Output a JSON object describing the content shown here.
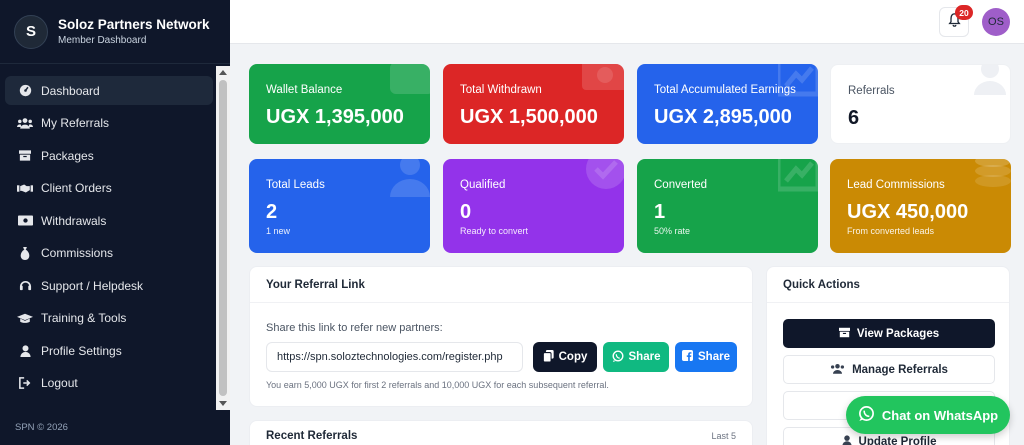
{
  "brand": {
    "initial": "S",
    "name": "Soloz Partners Network",
    "subtitle": "Member Dashboard"
  },
  "nav": [
    {
      "label": "Dashboard",
      "icon": "dashboard-icon",
      "active": true
    },
    {
      "label": "My Referrals",
      "icon": "users-icon"
    },
    {
      "label": "Packages",
      "icon": "box-icon"
    },
    {
      "label": "Client Orders",
      "icon": "handshake-icon"
    },
    {
      "label": "Withdrawals",
      "icon": "money-icon"
    },
    {
      "label": "Commissions",
      "icon": "money-bag-icon"
    },
    {
      "label": "Support / Helpdesk",
      "icon": "headset-icon"
    },
    {
      "label": "Training & Tools",
      "icon": "graduation-cap-icon"
    },
    {
      "label": "Profile Settings",
      "icon": "user-icon"
    },
    {
      "label": "Logout",
      "icon": "logout-icon"
    }
  ],
  "footer": "SPN © 2026",
  "topbar": {
    "notification_count": "20",
    "avatar_initials": "OS"
  },
  "stats": {
    "wallet": {
      "label": "Wallet Balance",
      "value": "UGX 1,395,000"
    },
    "withdrawn": {
      "label": "Total Withdrawn",
      "value": "UGX 1,500,000"
    },
    "earnings": {
      "label": "Total Accumulated Earnings",
      "value": "UGX 2,895,000"
    },
    "referrals": {
      "label": "Referrals",
      "value": "6"
    },
    "leads": {
      "label": "Total Leads",
      "value": "2",
      "sub": "1 new"
    },
    "qualified": {
      "label": "Qualified",
      "value": "0",
      "sub": "Ready to convert"
    },
    "converted": {
      "label": "Converted",
      "value": "1",
      "sub": "50% rate"
    },
    "lead_commissions": {
      "label": "Lead Commissions",
      "value": "UGX 450,000",
      "sub": "From converted leads"
    }
  },
  "referral_link": {
    "title": "Your Referral Link",
    "instruction": "Share this link to refer new partners:",
    "url": "https://spn.soloztechnologies.com/register.php",
    "copy_label": "Copy",
    "whatsapp_label": "Share",
    "facebook_label": "Share",
    "note": "You earn 5,000 UGX for first 2 referrals and 10,000 UGX for each subsequent referral."
  },
  "quick_actions": {
    "title": "Quick Actions",
    "view_packages": "View Packages",
    "manage_referrals": "Manage Referrals",
    "update_profile": "Update Profile"
  },
  "recent": {
    "title": "Recent Referrals",
    "last": "Last 5"
  },
  "whatsapp_chat": "Chat on WhatsApp",
  "colors": {
    "sidebar": "#0f172a",
    "green": "#16a34a",
    "red": "#dc2626",
    "blue": "#2563eb",
    "purple": "#9333ea",
    "gold": "#ca8a04",
    "whatsapp": "#22c55e",
    "facebook": "#1877f2",
    "whatsapp_share": "#10b981"
  }
}
